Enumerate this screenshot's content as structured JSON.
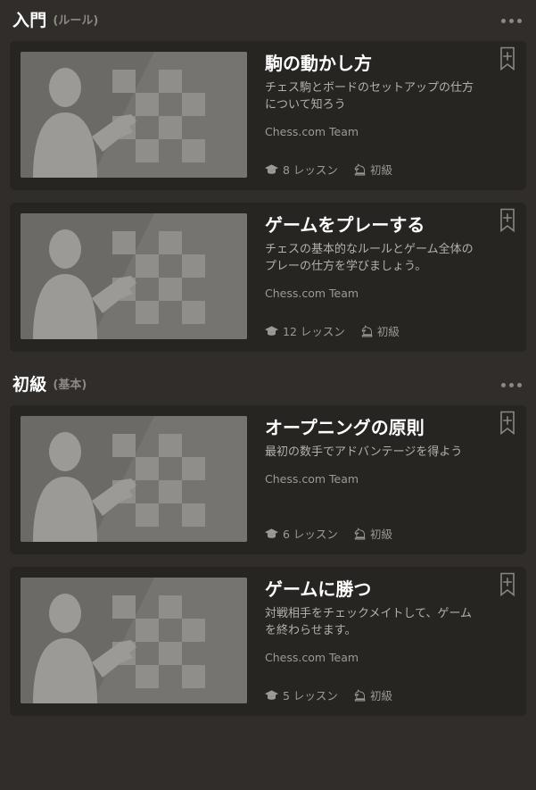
{
  "colors": {
    "page_bg": "#302d2b",
    "card_bg": "#262522",
    "title": "#ffffff",
    "muted": "#9e9993",
    "desc": "#b4afa9",
    "bookmark": "#8b8681"
  },
  "sections": [
    {
      "title": "入門",
      "subtitle": "(ルール)",
      "menu_icon": "kebab-menu-icon",
      "courses": [
        {
          "thumbnail_icon": "course-thumbnail-placeholder",
          "title": "駒の動かし方",
          "description": "チェス駒とボードのセットアップの仕方について知ろう",
          "author": "Chess.com Team",
          "lessons_label": "8 レッスン",
          "lessons_icon": "graduation-cap-icon",
          "level_label": "初級",
          "level_icon": "chess-knight-icon",
          "bookmark_icon": "bookmark-add-icon"
        },
        {
          "thumbnail_icon": "course-thumbnail-placeholder",
          "title": "ゲームをプレーする",
          "description": "チェスの基本的なルールとゲーム全体のプレーの仕方を学びましょう。",
          "author": "Chess.com Team",
          "lessons_label": "12 レッスン",
          "lessons_icon": "graduation-cap-icon",
          "level_label": "初級",
          "level_icon": "chess-knight-icon",
          "bookmark_icon": "bookmark-add-icon"
        }
      ]
    },
    {
      "title": "初級",
      "subtitle": "(基本)",
      "menu_icon": "kebab-menu-icon",
      "courses": [
        {
          "thumbnail_icon": "course-thumbnail-placeholder",
          "title": "オープニングの原則",
          "description": "最初の数手でアドバンテージを得よう",
          "author": "Chess.com Team",
          "lessons_label": "6 レッスン",
          "lessons_icon": "graduation-cap-icon",
          "level_label": "初級",
          "level_icon": "chess-knight-icon",
          "bookmark_icon": "bookmark-add-icon"
        },
        {
          "thumbnail_icon": "course-thumbnail-placeholder",
          "title": "ゲームに勝つ",
          "description": "対戦相手をチェックメイトして、ゲームを終わらせます。",
          "author": "Chess.com Team",
          "lessons_label": "5 レッスン",
          "lessons_icon": "graduation-cap-icon",
          "level_label": "初級",
          "level_icon": "chess-knight-icon",
          "bookmark_icon": "bookmark-add-icon"
        }
      ]
    }
  ]
}
